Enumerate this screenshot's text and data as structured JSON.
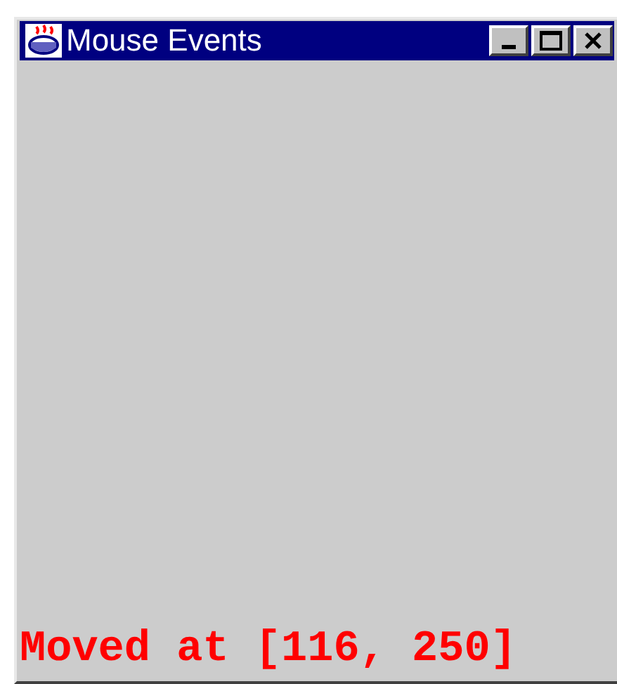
{
  "window": {
    "title": "Mouse Events"
  },
  "canvas": {
    "message": "Moved at [116, 250]"
  }
}
